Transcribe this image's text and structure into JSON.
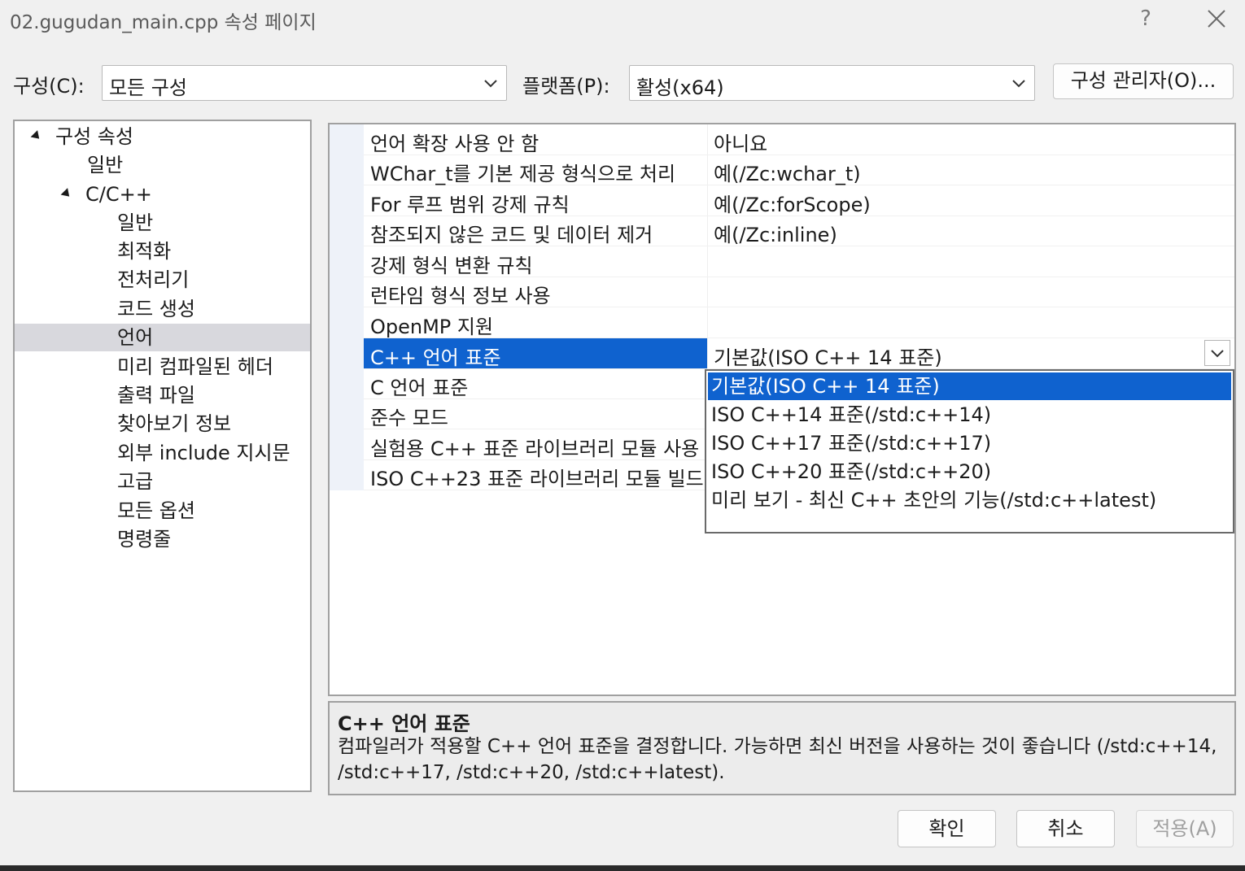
{
  "window": {
    "title": "02.gugudan_main.cpp 속성 페이지",
    "help": "?"
  },
  "config": {
    "config_label": "구성(C):",
    "config_value": "모든 구성",
    "platform_label": "플랫폼(P):",
    "platform_value": "활성(x64)",
    "manager_button": "구성 관리자(O)..."
  },
  "tree": {
    "root": "구성 속성",
    "general": "일반",
    "cpp": "C/C++",
    "children": [
      "일반",
      "최적화",
      "전처리기",
      "코드 생성",
      "언어",
      "미리 컴파일된 헤더",
      "출력 파일",
      "찾아보기 정보",
      "외부 include 지시문",
      "고급",
      "모든 옵션",
      "명령줄"
    ],
    "selected": "언어"
  },
  "properties": [
    {
      "name": "언어 확장 사용 안 함",
      "value": "아니요"
    },
    {
      "name": "WChar_t를 기본 제공 형식으로 처리",
      "value": "예(/Zc:wchar_t)"
    },
    {
      "name": "For 루프 범위 강제 규칙",
      "value": "예(/Zc:forScope)"
    },
    {
      "name": "참조되지 않은 코드 및 데이터 제거",
      "value": "예(/Zc:inline)"
    },
    {
      "name": "강제 형식 변환 규칙",
      "value": ""
    },
    {
      "name": "런타임 형식 정보 사용",
      "value": ""
    },
    {
      "name": "OpenMP 지원",
      "value": ""
    },
    {
      "name": "C++ 언어 표준",
      "value": "기본값(ISO C++ 14 표준)"
    },
    {
      "name": "C 언어 표준",
      "value": ""
    },
    {
      "name": "준수 모드",
      "value": ""
    },
    {
      "name": "실험용 C++ 표준 라이브러리 모듈 사용",
      "value": ""
    },
    {
      "name": "ISO C++23 표준 라이브러리 모듈 빌드",
      "value": ""
    }
  ],
  "dropdown": {
    "options": [
      "기본값(ISO C++ 14 표준)",
      "ISO C++14 표준(/std:c++14)",
      "ISO C++17 표준(/std:c++17)",
      "ISO C++20 표준(/std:c++20)",
      "미리 보기 - 최신 C++ 초안의 기능(/std:c++latest)"
    ],
    "selected_index": 0
  },
  "description": {
    "title": "C++ 언어 표준",
    "text": "컴파일러가 적용할 C++ 언어 표준을 결정합니다. 가능하면 최신 버전을 사용하는 것이 좋습니다 (/std:c++14, /std:c++17, /std:c++20, /std:c++latest)."
  },
  "buttons": {
    "ok": "확인",
    "cancel": "취소",
    "apply": "적용(A)"
  },
  "colors": {
    "selection": "#0f62cf",
    "tree_selection": "#d8d8dd"
  }
}
